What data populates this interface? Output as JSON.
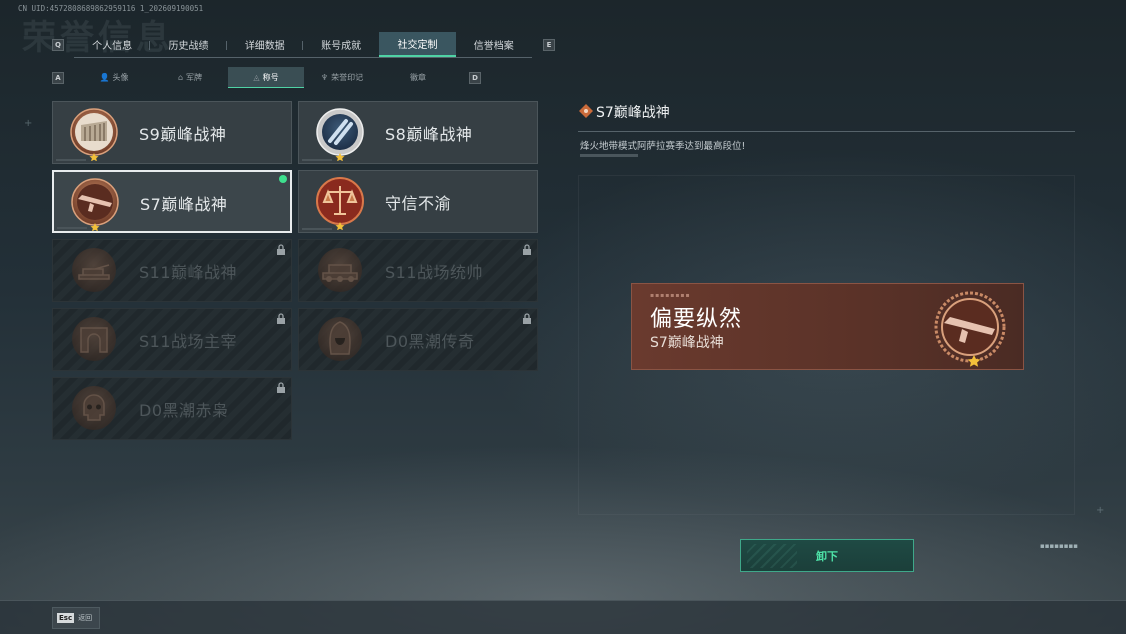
{
  "uid": "CN UID:4572808689862959116 1_202609190051",
  "bg_title": "荣誉信息",
  "keys": {
    "tab_prev": "Q",
    "tab_next": "E",
    "sub_prev": "A",
    "sub_next": "D"
  },
  "tabs": [
    {
      "label": "个人信息",
      "active": false
    },
    {
      "label": "历史战绩",
      "active": false
    },
    {
      "label": "详细数据",
      "active": false
    },
    {
      "label": "账号成就",
      "active": false
    },
    {
      "label": "社交定制",
      "active": true
    },
    {
      "label": "信誉档案",
      "active": false
    }
  ],
  "subtabs": [
    {
      "label": "头像",
      "icon": "person-icon",
      "active": false
    },
    {
      "label": "军牌",
      "icon": "dogtag-icon",
      "active": false
    },
    {
      "label": "称号",
      "icon": "title-icon",
      "active": true
    },
    {
      "label": "荣誉印记",
      "icon": "emblem-icon",
      "active": false
    },
    {
      "label": "徽章",
      "icon": "",
      "active": false
    }
  ],
  "titles": [
    {
      "name": "S9巅峰战神",
      "state": "unlocked",
      "medal": "building-medal"
    },
    {
      "name": "S8巅峰战神",
      "state": "unlocked",
      "medal": "blue-bullets-medal"
    },
    {
      "name": "S7巅峰战神",
      "state": "selected",
      "medal": "rifle-medal"
    },
    {
      "name": "守信不渝",
      "state": "unlocked",
      "medal": "scales-medal"
    },
    {
      "name": "S11巅峰战神",
      "state": "locked",
      "medal": "tank-medal"
    },
    {
      "name": "S11战场统帅",
      "state": "locked",
      "medal": "apc-medal"
    },
    {
      "name": "S11战场主宰",
      "state": "locked",
      "medal": "arch-medal"
    },
    {
      "name": "D0黑潮传奇",
      "state": "locked",
      "medal": "hooded-medal"
    },
    {
      "name": "D0黑潮赤枭",
      "state": "locked",
      "medal": "skull-medal"
    }
  ],
  "detail": {
    "title": "S7巅峰战神",
    "description": "烽火地带模式阿萨拉赛季达到最高段位!"
  },
  "preview": {
    "player_name": "偏要纵然",
    "title": "S7巅峰战神"
  },
  "unequip_label": "卸下",
  "esc": {
    "key": "Esc",
    "label": "返回"
  },
  "colors": {
    "accent": "#4fd3a5",
    "equipped_dot": "#3ee08e",
    "preview_bg": "#5a3228",
    "medal_bronze": "#a8674a"
  }
}
